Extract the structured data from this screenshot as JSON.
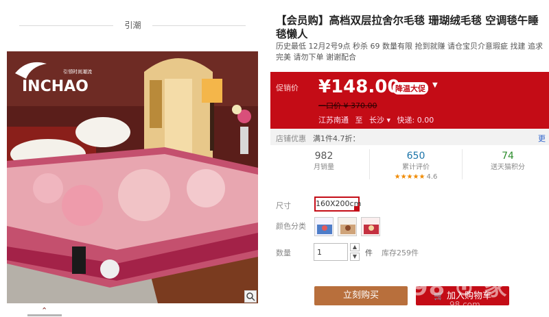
{
  "gallery": {
    "brand_title": "引潮",
    "logo_text": "INCHAO",
    "logo_small_text": "引领时尚潮流"
  },
  "product": {
    "title": "【会员购】高档双层拉舍尔毛毯 珊瑚绒毛毯 空调毯午睡毯懒人",
    "subtitle": "历史最低 12月2号9点 秒杀 69 数量有限 抢到就赚 请仓宝贝介意瑕疵 找建 追求完美 请勿下单 谢谢配合"
  },
  "price_panel": {
    "label": "促销价",
    "price": "¥148.00",
    "promo_badge": "降温大促",
    "old_price": "一口价 ¥ 370.00",
    "ship_from": "江苏南通",
    "ship_to_prefix": "至",
    "ship_to": "长沙 ▾",
    "shipping_fee": "快递: 0.00"
  },
  "store_discount": {
    "label": "店铺优惠",
    "value": "满1件4.7折：",
    "more": "更"
  },
  "stats": {
    "monthly_sales": {
      "num": "982",
      "label": "月销量"
    },
    "reviews": {
      "num": "650",
      "label": "累计评价",
      "stars": "★★★★★",
      "score": "4.6"
    },
    "points": {
      "num": "74",
      "label": "送天猫积分"
    }
  },
  "options": {
    "size_label": "尺寸",
    "size_value": "160X200cm",
    "color_label": "颜色分类",
    "qty_label": "数量",
    "qty_value": "1",
    "qty_unit": "件",
    "stock": "库存259件"
  },
  "actions": {
    "buy_label": "立刻购买",
    "cart_label": "加入购物车"
  },
  "watermark": {
    "text": "98 ⊙ 家",
    "small": "98.com"
  },
  "colors": {
    "primary_red": "#c40c16",
    "buy_brown": "#b86f3c",
    "review_blue": "#1a73a8",
    "points_green": "#2c8c2c"
  }
}
